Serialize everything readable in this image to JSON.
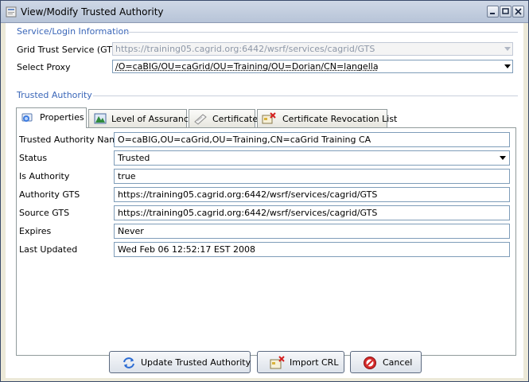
{
  "window": {
    "title": "View/Modify Trusted Authority",
    "controls": [
      "minimize",
      "maximize",
      "close"
    ]
  },
  "service_group": {
    "title": "Service/Login Information",
    "gts_label": "Grid Trust Service (GTS)",
    "gts_value": "https://training05.cagrid.org:6442/wsrf/services/cagrid/GTS",
    "proxy_label": "Select Proxy",
    "proxy_value": "/O=caBIG/OU=caGrid/OU=Training/OU=Dorian/CN=langella"
  },
  "authority_group": {
    "title": "Trusted Authority"
  },
  "tabs": [
    {
      "label": "Properties",
      "icon": "properties-icon",
      "active": true
    },
    {
      "label": "Level of Assurance",
      "icon": "level-of-assurance-icon",
      "active": false
    },
    {
      "label": "Certificate",
      "icon": "certificate-icon",
      "active": false
    },
    {
      "label": "Certificate Revocation List",
      "icon": "crl-icon",
      "active": false
    }
  ],
  "properties": {
    "name_label": "Trusted Authority Name",
    "name_value": "O=caBIG,OU=caGrid,OU=Training,CN=caGrid Training CA",
    "status_label": "Status",
    "status_value": "Trusted",
    "is_authority_label": "Is Authority",
    "is_authority_value": "true",
    "authority_gts_label": "Authority GTS",
    "authority_gts_value": "https://training05.cagrid.org:6442/wsrf/services/cagrid/GTS",
    "source_gts_label": "Source GTS",
    "source_gts_value": "https://training05.cagrid.org:6442/wsrf/services/cagrid/GTS",
    "expires_label": "Expires",
    "expires_value": "Never",
    "last_updated_label": "Last Updated",
    "last_updated_value": "Wed Feb 06 12:52:17 EST 2008"
  },
  "buttons": {
    "update_label": "Update Trusted Authority",
    "import_label": "Import CRL",
    "cancel_label": "Cancel"
  },
  "colors": {
    "group_title": "#3a66b8",
    "field_border": "#7f9db9",
    "titlebar": "#b7c4d8"
  }
}
